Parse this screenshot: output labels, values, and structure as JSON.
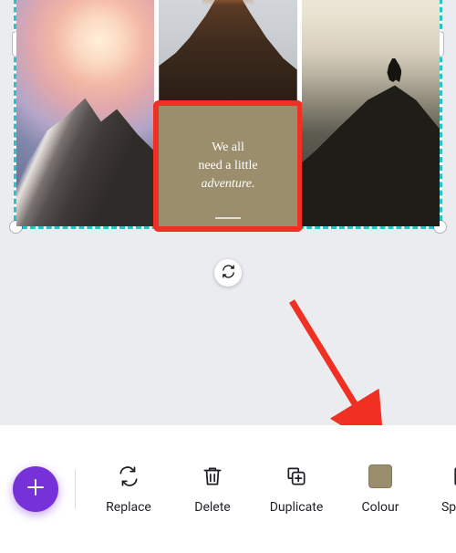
{
  "canvas": {
    "quote": {
      "line1": "We all",
      "line2": "need a little",
      "line3": "adventure."
    },
    "quote_bg_color": "#9a8e6d"
  },
  "toolbar": {
    "items": [
      {
        "label": "Replace"
      },
      {
        "label": "Delete"
      },
      {
        "label": "Duplicate"
      },
      {
        "label": "Colour"
      },
      {
        "label": "Spacing"
      }
    ],
    "colour_swatch": "#9a8e6d"
  }
}
